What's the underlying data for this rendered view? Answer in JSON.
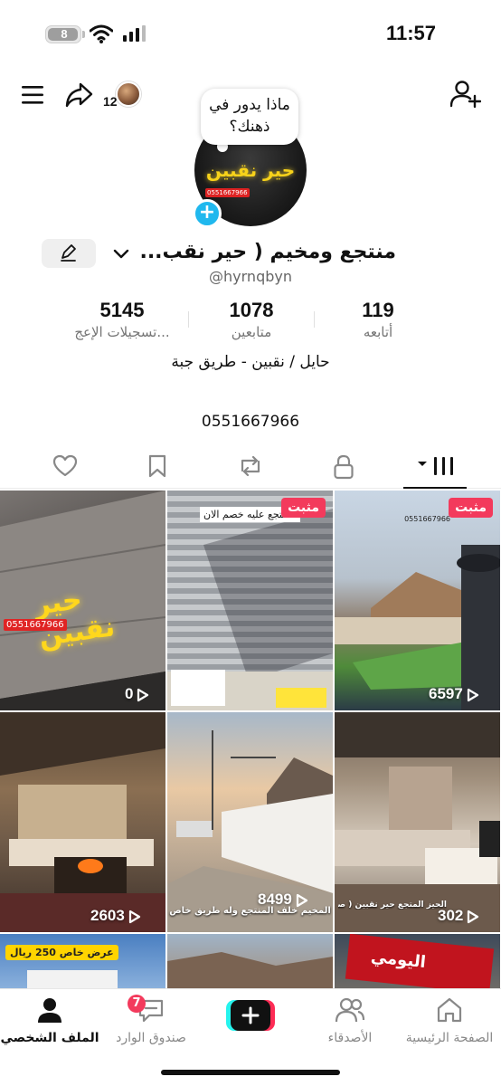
{
  "status_bar": {
    "time": "11:57",
    "battery": "8"
  },
  "header": {
    "visitor_count": "12"
  },
  "profile": {
    "note": "ماذا يدور في ذهنك؟",
    "avatar_sign": "حير نقبين",
    "avatar_phone": "0551667966",
    "name": "منتجع ومخيم ( حير نقب...",
    "username": "@hyrnqbyn",
    "stats": [
      {
        "value": "119",
        "label": "أتابعه"
      },
      {
        "value": "1078",
        "label": "متابعين"
      },
      {
        "value": "5145",
        "label": "تسجيلات الإعج..."
      }
    ],
    "bio_location": "حايل / نقبين - طريق جبة",
    "bio_phone": "0551667966"
  },
  "grid": {
    "pinned_label": "مثبت",
    "items": [
      {
        "views": "0",
        "caption": "حير نقبين",
        "phone": "0551667966"
      },
      {
        "views": "",
        "pinned": true,
        "caption": "المنتجع عليه خصم الان"
      },
      {
        "views": "6597",
        "pinned": true,
        "caption": "0551667966"
      },
      {
        "views": "2603",
        "caption": ""
      },
      {
        "views": "8499",
        "caption": "المخيم خلف المنتجع وله طريق خاص"
      },
      {
        "views": "302",
        "caption": "الحيز المتجع حير نقبين ( صالة"
      },
      {
        "views": "",
        "caption": "عرض خاص 250 ريال"
      },
      {
        "views": "",
        "caption": ""
      },
      {
        "views": "",
        "caption": "اليومي"
      }
    ]
  },
  "bottom_nav": {
    "items": [
      {
        "label": "الصفحة الرئيسية",
        "icon": "home-icon"
      },
      {
        "label": "الأصدقاء",
        "icon": "friends-icon"
      },
      {
        "label": "",
        "icon": "create-icon"
      },
      {
        "label": "صندوق الوارد",
        "icon": "inbox-icon",
        "badge": "7"
      },
      {
        "label": "الملف الشخصي",
        "icon": "profile-icon"
      }
    ]
  }
}
